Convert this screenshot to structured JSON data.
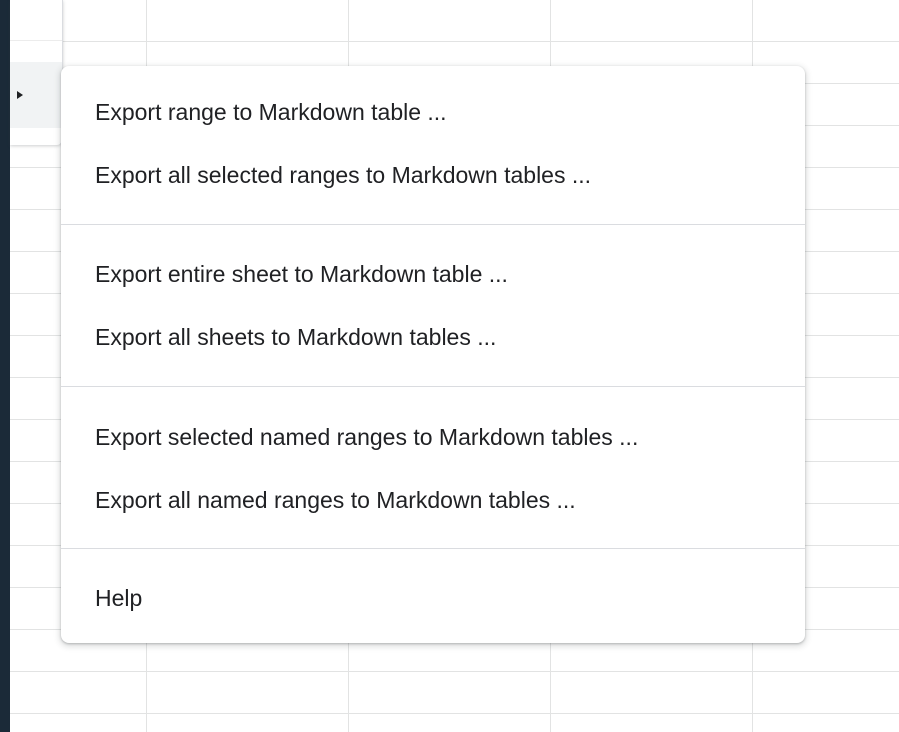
{
  "menu": {
    "items": [
      {
        "label": "Export range to Markdown table ..."
      },
      {
        "label": "Export all selected ranges to Markdown tables ..."
      },
      {
        "label": "Export entire sheet to Markdown table ..."
      },
      {
        "label": "Export all sheets to Markdown tables ..."
      },
      {
        "label": "Export selected named ranges to Markdown tables ..."
      },
      {
        "label": "Export all named ranges to Markdown tables ..."
      },
      {
        "label": "Help"
      }
    ]
  },
  "icons": {
    "submenu_indicator": "submenu-arrow-icon"
  }
}
